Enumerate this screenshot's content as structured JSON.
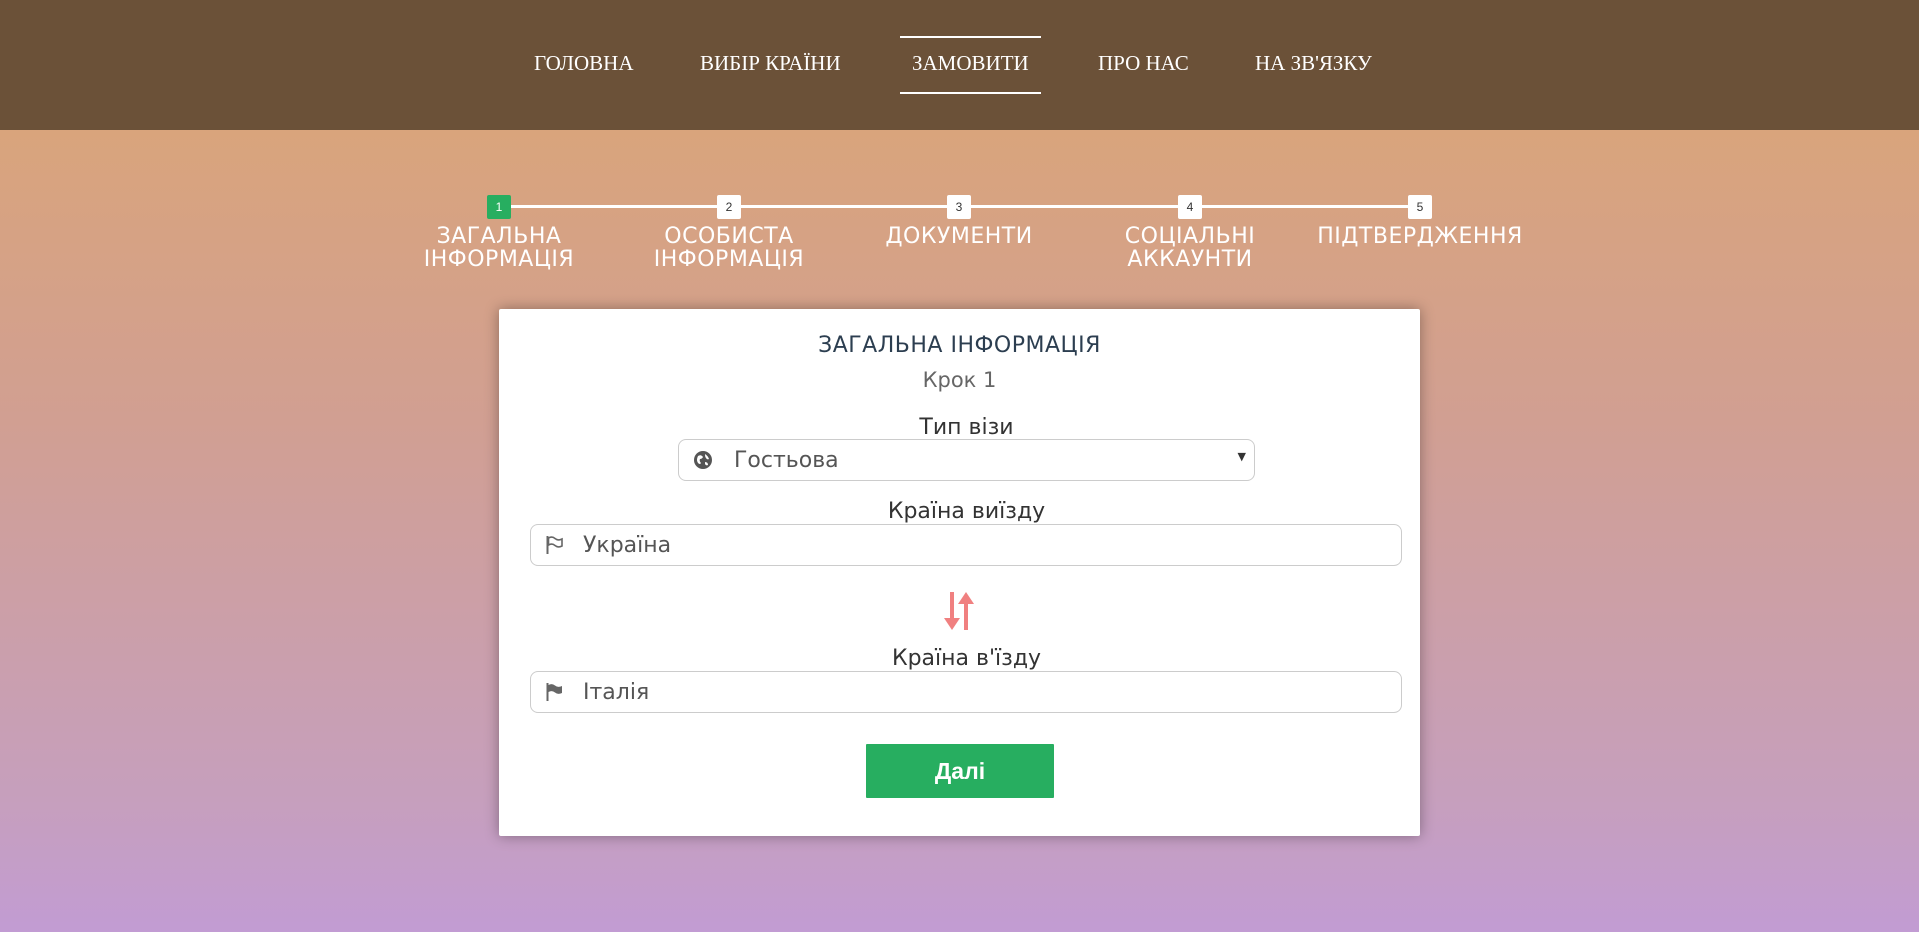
{
  "nav": {
    "items": [
      {
        "label": "ГОЛОВНА",
        "active": false
      },
      {
        "label": "ВИБІР КРАЇНИ",
        "active": false
      },
      {
        "label": "ЗАМОВИТИ",
        "active": true
      },
      {
        "label": "ПРО НАС",
        "active": false
      },
      {
        "label": "НА ЗВ'ЯЗКУ",
        "active": false
      }
    ]
  },
  "progress": {
    "current_step": 1,
    "steps": [
      {
        "number": "1",
        "label_line1": "ЗАГАЛЬНА",
        "label_line2": "ІНФОРМАЦІЯ"
      },
      {
        "number": "2",
        "label_line1": "ОСОБИСТА",
        "label_line2": "ІНФОРМАЦІЯ"
      },
      {
        "number": "3",
        "label_line1": "ДОКУМЕНТИ",
        "label_line2": ""
      },
      {
        "number": "4",
        "label_line1": "СОЦІАЛЬНІ",
        "label_line2": "АККАУНТИ"
      },
      {
        "number": "5",
        "label_line1": "ПІДТВЕРДЖЕННЯ",
        "label_line2": ""
      }
    ]
  },
  "form": {
    "title": "ЗАГАЛЬНА ІНФОРМАЦІЯ",
    "subtitle": "Крок 1",
    "visa_type": {
      "label": "Тип візи",
      "value": "Гостьова",
      "icon": "globe-icon"
    },
    "departure_country": {
      "label": "Країна виїзду",
      "value": "Україна",
      "icon": "flag-outline-icon"
    },
    "swap_icon": "swap-arrows-icon",
    "arrival_country": {
      "label": "Країна в'їзду",
      "value": "Італія",
      "icon": "flag-solid-icon"
    },
    "next_label": "Далі"
  },
  "colors": {
    "header_bg": "#6b5138",
    "accent_green": "#27ae60",
    "swap_arrows": "#f08080",
    "gradient_top": "#d9a47c",
    "gradient_bottom": "#c29cd3"
  }
}
